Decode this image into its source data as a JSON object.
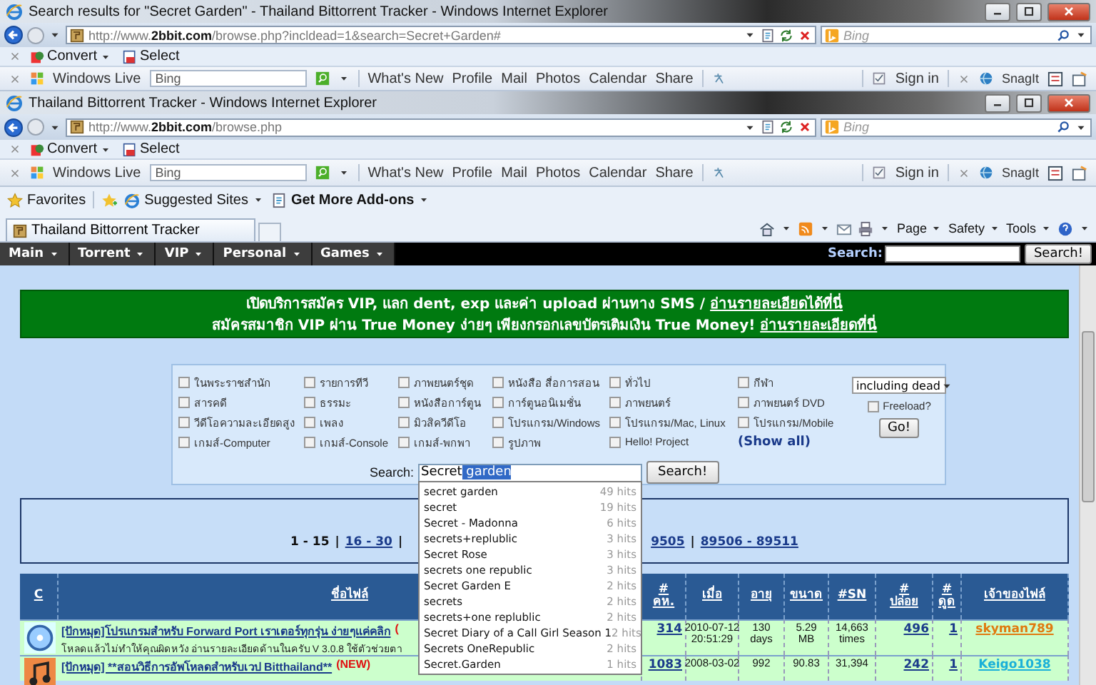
{
  "windows": [
    {
      "title": "Search results for \"Secret Garden\" - Thailand Bittorrent Tracker - Windows Internet Explorer",
      "url_prefix": "http://www.",
      "url_domain": "2bbit.com",
      "url_path": "/browse.php?incldead=1&search=Secret+Garden#",
      "search_placeholder": "Bing",
      "command_items": [
        "Convert",
        "Select"
      ],
      "live_brand": "Windows Live",
      "live_search": "Bing",
      "live_links": [
        "What's New",
        "Profile",
        "Mail",
        "Photos",
        "Calendar",
        "Share"
      ],
      "sign_in": "Sign in",
      "snagit": "SnagIt"
    },
    {
      "title": "Thailand Bittorrent Tracker - Windows Internet Explorer",
      "url_prefix": "http://www.",
      "url_domain": "2bbit.com",
      "url_path": "/browse.php",
      "search_placeholder": "Bing",
      "command_items": [
        "Convert",
        "Select"
      ],
      "live_brand": "Windows Live",
      "live_search": "Bing",
      "live_links": [
        "What's New",
        "Profile",
        "Mail",
        "Photos",
        "Calendar",
        "Share"
      ],
      "sign_in": "Sign in",
      "snagit": "SnagIt"
    }
  ],
  "favorites": {
    "label": "Favorites",
    "items": [
      "Suggested Sites",
      "Get More Add-ons"
    ]
  },
  "tab": {
    "title": "Thailand Bittorrent Tracker"
  },
  "commands": [
    "Page",
    "Safety",
    "Tools"
  ],
  "nav": {
    "menus": [
      "Main",
      "Torrent",
      "VIP",
      "Personal",
      "Games"
    ],
    "search_label": "Search:",
    "button": "Search!"
  },
  "banner": {
    "lines": [
      {
        "text": "เปิดบริการสมัคร VIP, แลก dent, exp และค่า upload ผ่านทาง SMS /",
        "link": "อ่านรายละเอียดได้ที่นี่"
      },
      {
        "text": "สมัครสมาชิก VIP ผ่าน True Money ง่ายๆ เพียงกรอกเลขบัตรเติมเงิน True Money!",
        "link": "อ่านรายละเอียดที่นี่"
      }
    ]
  },
  "categories": [
    {
      "label": "ในพระราชสำนัก",
      "checked": false
    },
    {
      "label": "รายการทีวี",
      "checked": false
    },
    {
      "label": "ภาพยนตร์ชุด",
      "checked": false
    },
    {
      "label": "หนังสือ สื่อการสอน",
      "checked": false
    },
    {
      "label": "ทั่วไป",
      "checked": false
    },
    {
      "label": "กีฬา",
      "checked": false
    },
    {
      "label": "สารคดี",
      "checked": false
    },
    {
      "label": "ธรรมะ",
      "checked": false
    },
    {
      "label": "หนังสือการ์ตูน",
      "checked": false
    },
    {
      "label": "การ์ตูนอนิเมชั่น",
      "checked": false
    },
    {
      "label": "ภาพยนตร์",
      "checked": false
    },
    {
      "label": "ภาพยนตร์ DVD",
      "checked": false
    },
    {
      "label": "วีดีโอความละเอียดสูง",
      "checked": false
    },
    {
      "label": "เพลง",
      "checked": false
    },
    {
      "label": "มิวสิควีดีโอ",
      "checked": false
    },
    {
      "label": "โปรแกรม/Windows",
      "checked": false
    },
    {
      "label": "โปรแกรม/Mac, Linux",
      "checked": false
    },
    {
      "label": "โปรแกรม/Mobile",
      "checked": false
    },
    {
      "label": "เกมส์-Computer",
      "checked": false
    },
    {
      "label": "เกมส์-Console",
      "checked": false
    },
    {
      "label": "เกมส์-พกพา",
      "checked": false
    },
    {
      "label": "รูปภาพ",
      "checked": false
    },
    {
      "label": "Hello! Project",
      "checked": false
    }
  ],
  "show_all": "(Show all)",
  "filter": {
    "value": "including dead",
    "freeload_label": "Freeload?",
    "freeload_checked": false,
    "go": "Go!"
  },
  "search": {
    "label": "Search:",
    "typed": "Secret",
    "selected_text": " garden",
    "button": "Search!"
  },
  "suggestions": [
    {
      "text": "secret garden",
      "hits": "49 hits"
    },
    {
      "text": "secret",
      "hits": "19 hits"
    },
    {
      "text": "Secret - Madonna",
      "hits": "6 hits"
    },
    {
      "text": "secrets+replublic",
      "hits": "3 hits"
    },
    {
      "text": "Secret Rose",
      "hits": "3 hits"
    },
    {
      "text": "secrets one republic",
      "hits": "3 hits"
    },
    {
      "text": "Secret Garden E",
      "hits": "2 hits"
    },
    {
      "text": "secrets",
      "hits": "2 hits"
    },
    {
      "text": "secrets+one replublic",
      "hits": "2 hits"
    },
    {
      "text": "Secret Diary of a Call Girl Season 1",
      "hits": "2 hits"
    },
    {
      "text": "Secrets OneRepublic",
      "hits": "2 hits"
    },
    {
      "text": "Secret.Garden",
      "hits": "1 hits"
    }
  ],
  "pagination": {
    "separator": "|",
    "links_before": [
      {
        "label": "1 - 15",
        "selected": true
      },
      {
        "label": "16 - 30",
        "selected": false
      }
    ],
    "links_after": [
      {
        "label": "9505",
        "selected": false
      },
      {
        "label": "89506 - 89511",
        "selected": false
      }
    ]
  },
  "table": {
    "columns": [
      "C",
      "ชื่อไฟล์",
      "#\nคห.",
      "เมื่อ",
      "อายุ",
      "ขนาด",
      "#SN",
      "#\nปล่อย",
      "#\nดูด",
      "เจ้าของไฟล์"
    ],
    "rows": [
      {
        "title": "[ปักหมุด]โปรแกรมสำหรับ Forward Port เราเตอร์ทุกรุ่น ง่ายๆแค่คลิก",
        "tag": "(",
        "subtitle": "โหลดแล้วไม่ทำให้คุณผิดหวัง อ่านรายละเอียดด้านในครับ V 3.0.8 ใช้ตัวช่วยตา",
        "comments": "314",
        "added": "2010-07-12\n20:51:29",
        "age": "130\ndays",
        "size": "5.29\nMB",
        "snatched": "14,663\ntimes",
        "seeders": "496",
        "leechers": "1",
        "owner": "skyman789",
        "color": "#e07a10"
      },
      {
        "title": "[ปักหมุด] **สอนวิธีการอัพโหลดสำหรับเวป Bitthailand**",
        "tag": "(NEW)",
        "comments": "1083",
        "added": "2008-03-02",
        "age": "992",
        "size": "90.83",
        "snatched": "31,394",
        "seeders": "242",
        "leechers": "1",
        "owner": "Keigo1038",
        "color": "#1ab0d8"
      }
    ]
  }
}
